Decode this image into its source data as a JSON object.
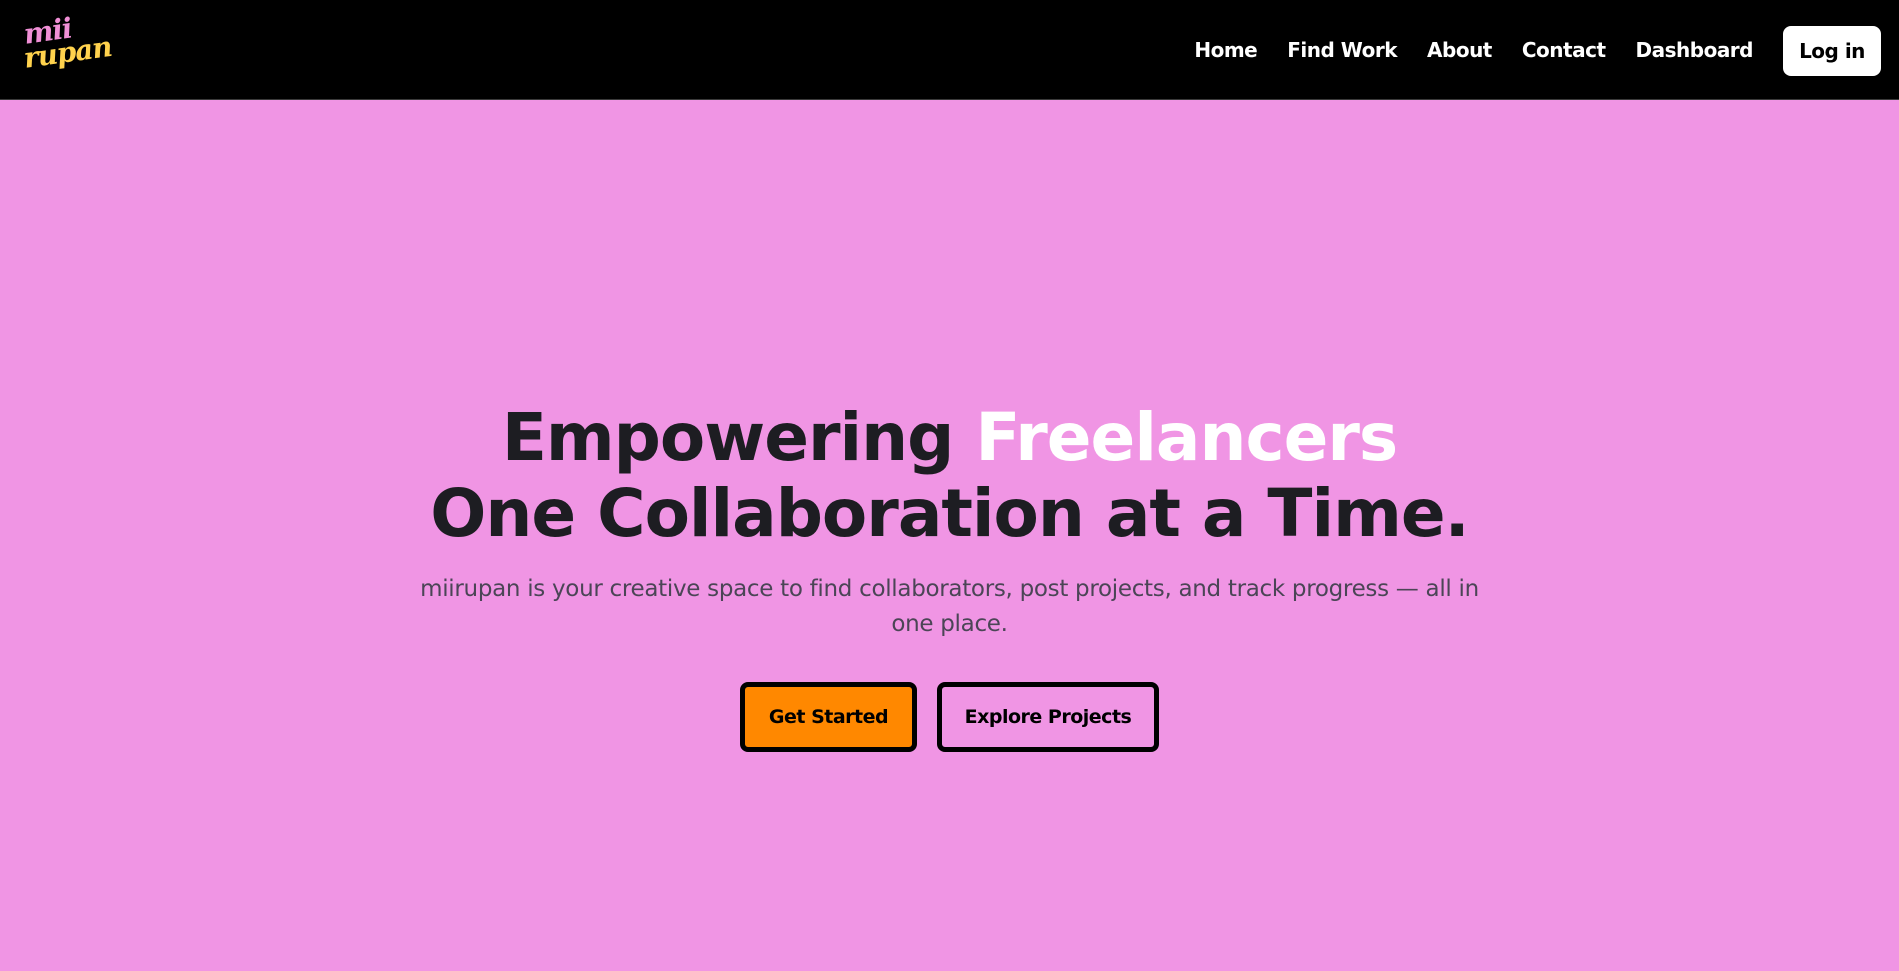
{
  "brand": {
    "logo_line1": "mii",
    "logo_line2": "rupan"
  },
  "nav": {
    "items": [
      {
        "label": "Home"
      },
      {
        "label": "Find Work"
      },
      {
        "label": "About"
      },
      {
        "label": "Contact"
      },
      {
        "label": "Dashboard"
      }
    ],
    "login_label": "Log in"
  },
  "hero": {
    "headline_part1": "Empowering ",
    "headline_highlight": "Freelancers",
    "headline_line2": "One Collaboration at a Time.",
    "subtitle": "miirupan is your creative space to find collaborators, post projects, and track progress — all in one place.",
    "primary_cta": "Get Started",
    "secondary_cta": "Explore Projects"
  },
  "colors": {
    "background": "#f095e4",
    "navbar": "#000000",
    "headline": "#1d1d22",
    "highlight": "#ffffff",
    "primary_button": "#ff8800",
    "logo_pink": "#f08fd6",
    "logo_yellow": "#ffd24d"
  }
}
